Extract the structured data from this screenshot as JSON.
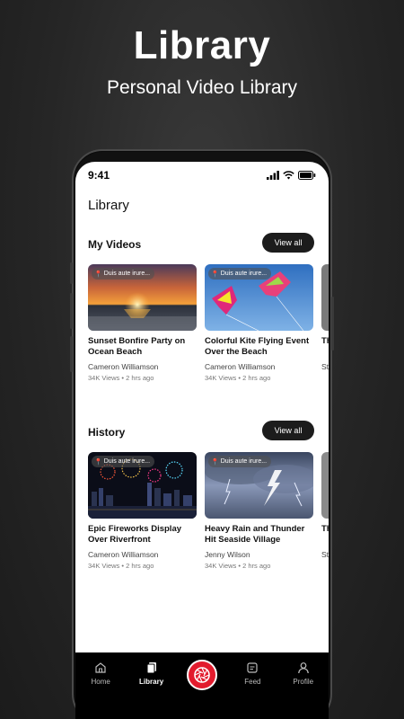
{
  "promo": {
    "title": "Library",
    "subtitle": "Personal Video Library"
  },
  "status_bar": {
    "time": "9:41"
  },
  "page": {
    "title": "Library"
  },
  "sections": [
    {
      "title": "My Videos",
      "view_all_label": "View all",
      "cards": [
        {
          "badge": "Duis aute irure...",
          "title": "Sunset Bonfire Party on Ocean Beach",
          "author": "Cameron Williamson",
          "meta": "34K Views • 2 hrs ago"
        },
        {
          "badge": "Duis aute irure...",
          "title": "Colorful Kite Flying Event Over the Beach",
          "author": "Cameron Williamson",
          "meta": "34K Views • 2 hrs ago"
        },
        {
          "badge": "",
          "title": "Th Th",
          "author": "St",
          "meta": ""
        }
      ]
    },
    {
      "title": "History",
      "view_all_label": "View all",
      "cards": [
        {
          "badge": "Duis aute irure...",
          "title": "Epic Fireworks Display Over Riverfront",
          "author": "Cameron Williamson",
          "meta": "34K Views • 2 hrs ago"
        },
        {
          "badge": "Duis aute irure...",
          "title": "Heavy Rain and Thunder Hit Seaside Village",
          "author": "Jenny Wilson",
          "meta": "34K Views • 2 hrs ago"
        },
        {
          "badge": "",
          "title": "Th Th",
          "author": "St",
          "meta": ""
        }
      ]
    }
  ],
  "tab_bar": {
    "home": "Home",
    "library": "Library",
    "feed": "Feed",
    "profile": "Profile",
    "active": "library"
  },
  "colors": {
    "accent": "#e21b2d",
    "tab_bar_bg": "#000000",
    "button_bg": "#1c1c1c"
  }
}
